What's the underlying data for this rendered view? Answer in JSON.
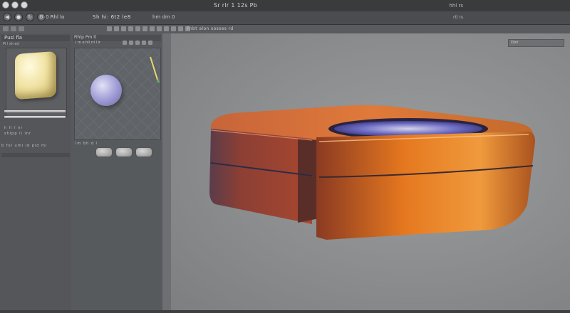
{
  "titlebar": {
    "title": "Sr rlr 1 12s Pb",
    "right_text": "hhl rs"
  },
  "toolbar": {
    "label": "0 Rhl lo",
    "menu": "Sh hi: 6t2 le8",
    "right": "hm dm 0",
    "status": "rtl rs"
  },
  "toolbar2": {
    "text": "Fnbt alon sosses rd"
  },
  "left_panel": {
    "title": "Pusl fla",
    "subtitle": "Pl l sh ed",
    "rows": [
      "h ll l nr",
      "shlpp ll lnr"
    ],
    "footer": "b fol uml ld pld ml"
  },
  "material_panel": {
    "tabs": "Fihlp   Pm lt",
    "subtabs": "l m e hll rrl l ir",
    "footer": "lm bh d l"
  },
  "viewport": {
    "field_text": "Dbrl"
  },
  "colors": {
    "shape_orange": "#e57a24",
    "shape_red": "#9a3b2c",
    "inner_blue": "#3b3a9e",
    "cube_yellow": "#f1e3a3",
    "sphere_lavender": "#a7a5db"
  }
}
